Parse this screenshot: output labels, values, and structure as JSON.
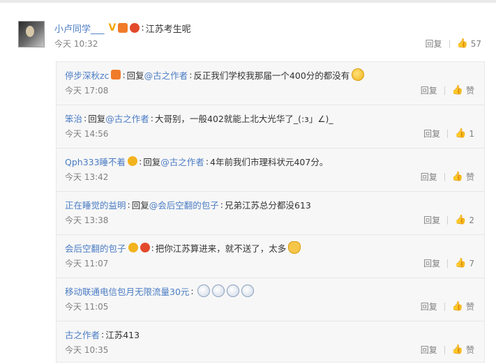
{
  "main": {
    "username": "小卢同学___",
    "text": "江苏考生呢",
    "time": "今天 10:32",
    "reply_label": "回复",
    "like_count": "57"
  },
  "replies": [
    {
      "username": "停步深秋zc",
      "prefix": "回复",
      "mention": "@古之作者",
      "text": "反正我们学校我那届一个400分的都没有",
      "time": "今天 17:08",
      "reply_label": "回复",
      "like": "赞"
    },
    {
      "username": "笨治",
      "prefix": "回复",
      "mention": "@古之作者",
      "text": "大哥别，一般402就能上北大光华了_(:з」∠)_",
      "time": "今天 14:56",
      "reply_label": "回复",
      "like": "1"
    },
    {
      "username": "Qph333睡不着",
      "prefix": "回复",
      "mention": "@古之作者",
      "text": "4年前我们市理科状元407分。",
      "time": "今天 13:42",
      "reply_label": "回复",
      "like": "赞"
    },
    {
      "username": "正在睡觉的益明",
      "prefix": "回复",
      "mention": "@会后空翻的包子",
      "text": "兄弟江苏总分都没613",
      "time": "今天 13:38",
      "reply_label": "回复",
      "like": "2"
    },
    {
      "username": "会后空翻的包子",
      "prefix": "",
      "mention": "",
      "text": "把你江苏算进来，就不送了，太多",
      "time": "今天 11:07",
      "reply_label": "回复",
      "like": "7"
    },
    {
      "username": "移动联通电信包月无限流量30元",
      "prefix": "",
      "mention": "",
      "text": "",
      "time": "今天 11:05",
      "reply_label": "回复",
      "like": "赞"
    },
    {
      "username": "古之作者",
      "prefix": "",
      "mention": "",
      "text": "江苏413",
      "time": "今天 10:35",
      "reply_label": "回复",
      "like": "赞"
    }
  ],
  "icons": {
    "thumb": "thumbs-up-icon",
    "verified": "verified-v-icon",
    "member": "member-badge-icon",
    "emoji": "emoji-icon"
  },
  "colors": {
    "link": "#4b7cc4",
    "meta": "#808080",
    "reply_bg": "#f7f7f7"
  }
}
